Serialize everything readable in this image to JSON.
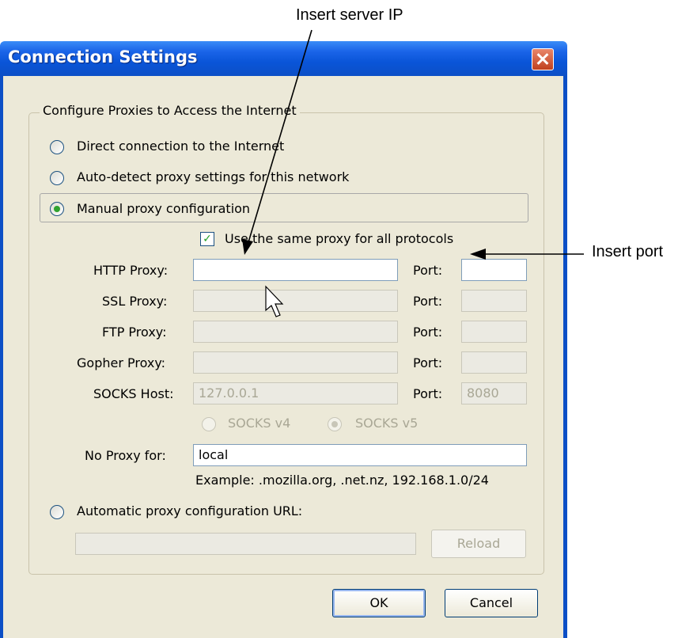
{
  "annotations": {
    "server_ip": "Insert server IP",
    "port": "Insert port"
  },
  "window": {
    "title": "Connection Settings"
  },
  "group": {
    "legend": "Configure Proxies to Access the Internet"
  },
  "options": {
    "direct": "Direct connection to the Internet",
    "auto_detect": "Auto-detect proxy settings for this network",
    "manual": "Manual proxy configuration",
    "auto_url": "Automatic proxy configuration URL:"
  },
  "same_proxy_label": "Use the same proxy for all protocols",
  "proxies": {
    "http_label": "HTTP Proxy:",
    "ssl_label": "SSL Proxy:",
    "ftp_label": "FTP Proxy:",
    "gopher_label": "Gopher Proxy:",
    "socks_label": "SOCKS Host:",
    "socks_value": "127.0.0.1",
    "port_label": "Port:",
    "socks_port_value": "8080"
  },
  "socks_versions": {
    "v4": "SOCKS v4",
    "v5": "SOCKS v5"
  },
  "no_proxy": {
    "label": "No Proxy for:",
    "value": "local",
    "example": "Example: .mozilla.org, .net.nz, 192.168.1.0/24"
  },
  "buttons": {
    "reload": "Reload",
    "ok": "OK",
    "cancel": "Cancel"
  },
  "colors": {
    "title_bar": "#0c4fc6",
    "dialog_bg": "#ece9d8",
    "radio_selected": "#2fa22f"
  }
}
